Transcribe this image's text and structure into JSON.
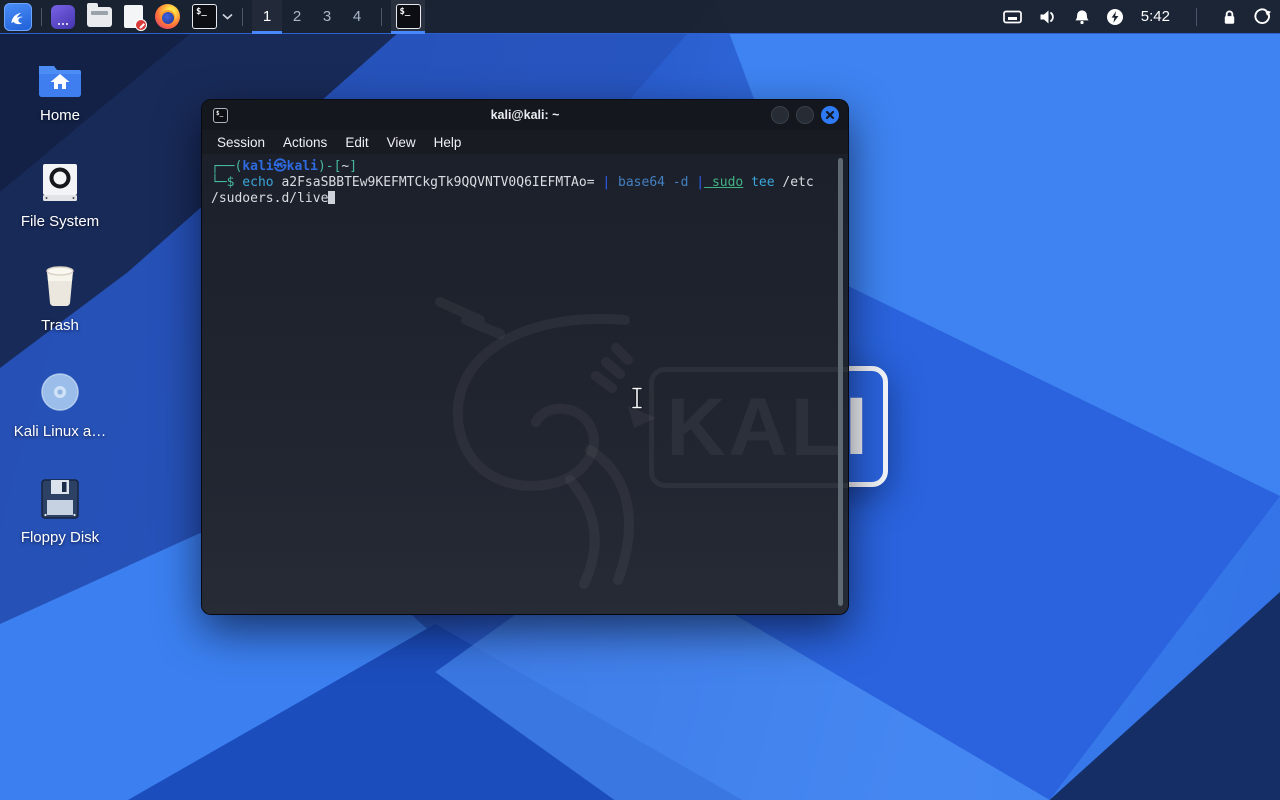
{
  "panel": {
    "workspaces": [
      "1",
      "2",
      "3",
      "4"
    ],
    "active_workspace": "1",
    "clock": "5:42",
    "terminal_glyph": "$_"
  },
  "desktop": {
    "icons": [
      {
        "label": "Home"
      },
      {
        "label": "File System"
      },
      {
        "label": "Trash"
      },
      {
        "label": "Kali Linux a…"
      },
      {
        "label": "Floppy Disk"
      }
    ],
    "watermark_text": "KALI"
  },
  "terminal": {
    "title": "kali@kali: ~",
    "menu": [
      "Session",
      "Actions",
      "Edit",
      "View",
      "Help"
    ],
    "line1": {
      "open": "┌──(",
      "user": "kali㉿kali",
      "sep": ")-[",
      "cwd": "~",
      "close": "]"
    },
    "line2": {
      "prompt": "└─$",
      "cmd": " echo",
      "arg": " a2FsaSBBTEw9KEFMTCkgTk9QQVNTV0Q6IEFMTAo=",
      "pipe1": " |",
      "cmd2": " base64 -d",
      "pipe2": " |",
      "sudo": " sudo",
      "cmd3": " tee",
      "arg2": " /etc"
    },
    "line3": "/sudoers.d/live"
  },
  "colors": {
    "accent_blue": "#4787ff",
    "panel_bg": "#1a2230",
    "close_button": "#2f7bf6",
    "prompt_teal": "#47b8a0",
    "user_blue": "#2f6be0",
    "command_cyan": "#3aa5d9",
    "option_blue": "#4380c2",
    "pipe_blue": "#2e5ff2",
    "sudo_green": "#41b383",
    "terminal_text": "#d9dce1"
  }
}
